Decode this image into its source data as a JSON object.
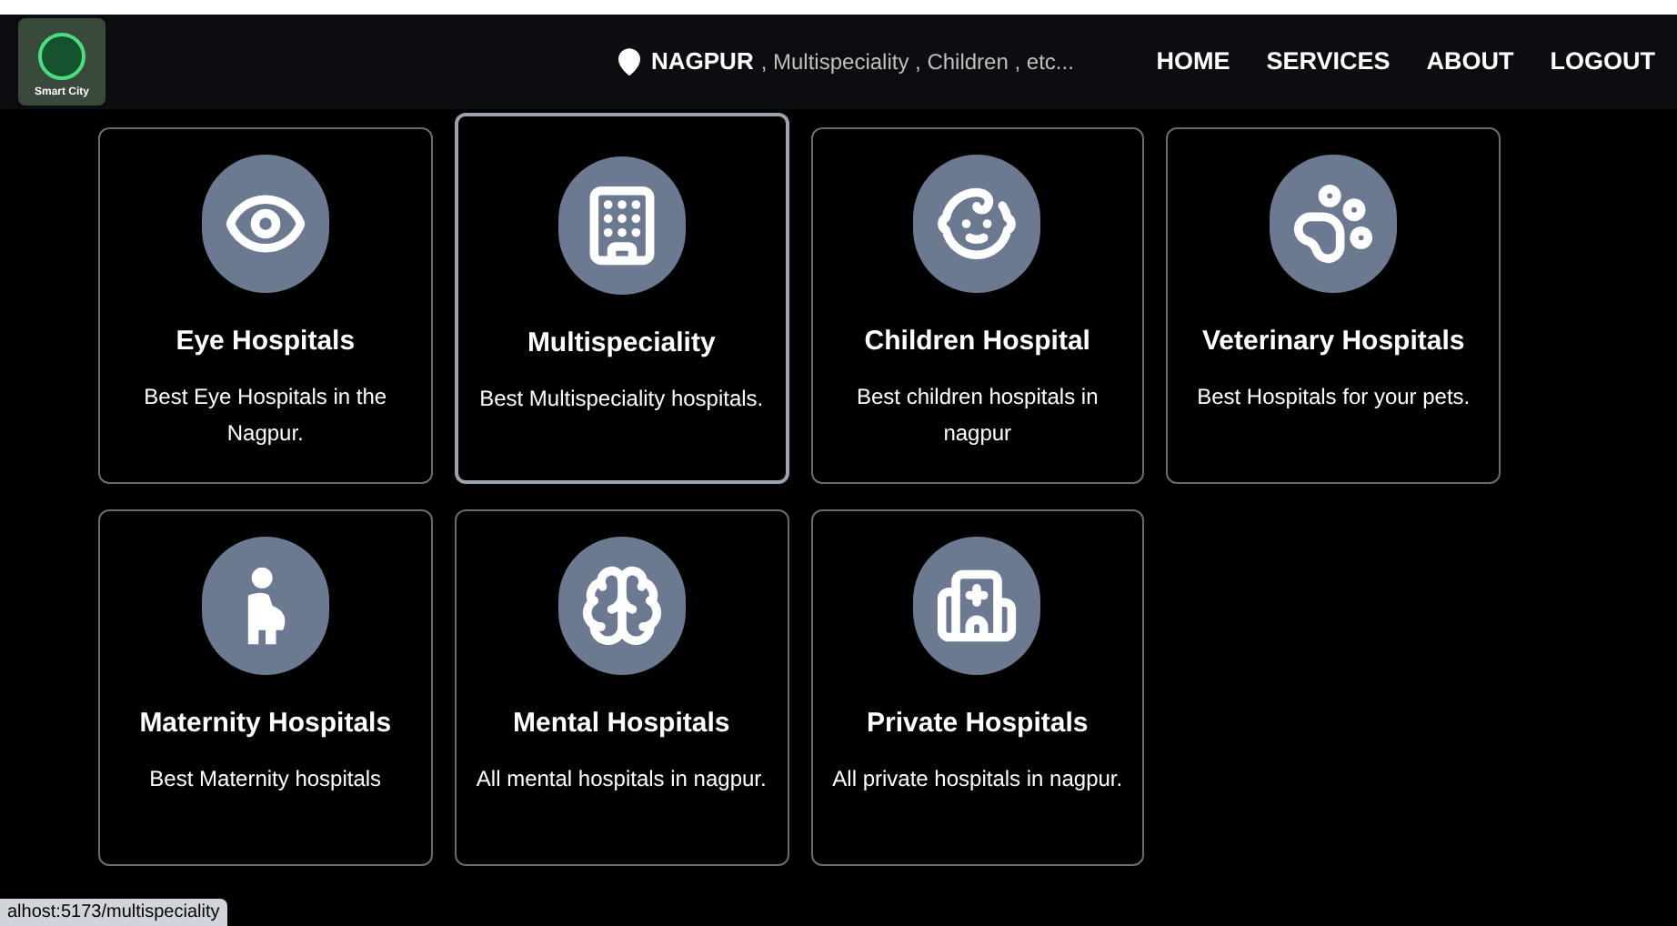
{
  "logo": {
    "text": "Smart City"
  },
  "search": {
    "location": "NAGPUR",
    "placeholder": ", Multispeciality , Children , etc..."
  },
  "nav": [
    "HOME",
    "SERVICES",
    "ABOUT",
    "LOGOUT"
  ],
  "cards": [
    {
      "title": "Eye Hospitals",
      "description": "Best Eye Hospitals in the Nagpur.",
      "selected": false
    },
    {
      "title": "Multispeciality",
      "description": "Best Multispeciality hospitals.",
      "selected": true
    },
    {
      "title": "Children Hospital",
      "description": "Best children hospitals in nagpur",
      "selected": false
    },
    {
      "title": "Veterinary Hospitals",
      "description": "Best Hospitals for your pets.",
      "selected": false
    },
    {
      "title": "Maternity Hospitals",
      "description": "Best Maternity hospitals",
      "selected": false
    },
    {
      "title": "Mental Hospitals",
      "description": "All mental hospitals in nagpur.",
      "selected": false
    },
    {
      "title": "Private Hospitals",
      "description": "All private hospitals in nagpur.",
      "selected": false
    }
  ],
  "status_bar": "alhost:5173/multispeciality"
}
